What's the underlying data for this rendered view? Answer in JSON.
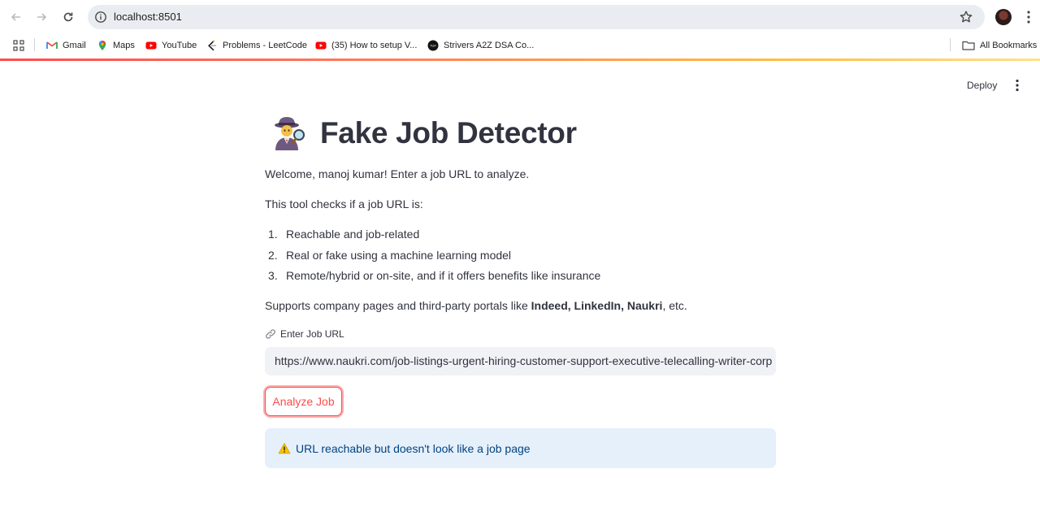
{
  "browser": {
    "url": "localhost:8501",
    "bookmarks": [
      {
        "label": "Gmail",
        "icon": "gmail-icon"
      },
      {
        "label": "Maps",
        "icon": "maps-icon"
      },
      {
        "label": "YouTube",
        "icon": "youtube-icon"
      },
      {
        "label": "Problems - LeetCode",
        "icon": "leetcode-icon"
      },
      {
        "label": "(35) How to setup V...",
        "icon": "youtube-icon"
      },
      {
        "label": "Strivers A2Z DSA Co...",
        "icon": "tuf-icon"
      }
    ],
    "all_bookmarks_label": "All Bookmarks"
  },
  "app_header": {
    "deploy_label": "Deploy"
  },
  "main": {
    "title": "Fake Job Detector",
    "title_emoji": "detective-icon",
    "welcome": "Welcome, manoj kumar! Enter a job URL to analyze.",
    "intro": "This tool checks if a job URL is:",
    "steps": [
      {
        "num": "1.",
        "text": "Reachable and job-related"
      },
      {
        "num": "2.",
        "text": "Real or fake using a machine learning model"
      },
      {
        "num": "3.",
        "text": "Remote/hybrid or on-site, and if it offers benefits like insurance"
      }
    ],
    "supports_prefix": "Supports company pages and third-party portals like ",
    "supports_bold": "Indeed, LinkedIn, Naukri",
    "supports_suffix": ", etc.",
    "input_label": "Enter Job URL",
    "input_value": "https://www.naukri.com/job-listings-urgent-hiring-customer-support-executive-telecalling-writer-corp",
    "analyze_label": "Analyze Job",
    "alert_text": "URL reachable but doesn't look like a job page"
  },
  "colors": {
    "primary": "#ff4b4b",
    "text": "#31333f",
    "alert_bg": "#e6f0fb",
    "alert_text": "#004280",
    "input_bg": "#f0f2f6"
  }
}
